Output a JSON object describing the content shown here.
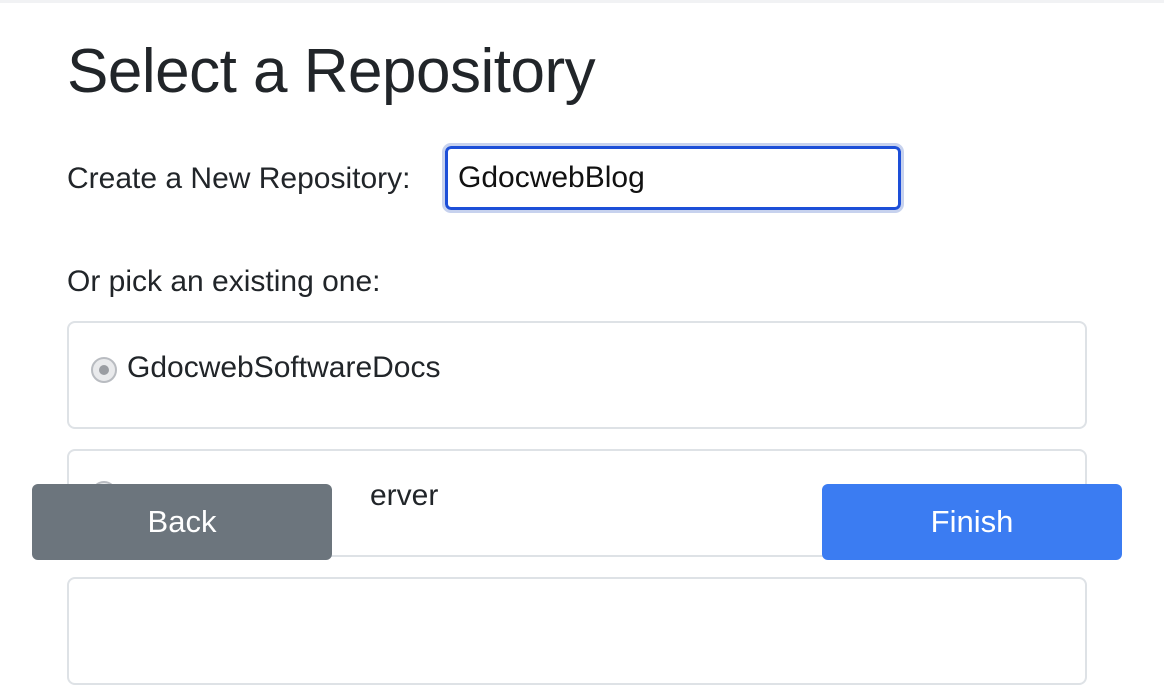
{
  "page": {
    "title": "Select a Repository"
  },
  "new_repo": {
    "label": "Create a New Repository:",
    "value": "GdocwebBlog"
  },
  "existing": {
    "label": "Or pick an existing one:",
    "repos": [
      {
        "name": "GdocwebSoftwareDocs",
        "selected": true
      },
      {
        "name": "erver",
        "selected": false,
        "partially_hidden": true
      },
      {
        "name": "",
        "selected": false,
        "partially_hidden": true
      }
    ]
  },
  "buttons": {
    "back_label": "Back",
    "finish_label": "Finish"
  },
  "colors": {
    "primary": "#3b7cf2",
    "secondary": "#6c757d",
    "input_focus_border": "#1d4fd8"
  }
}
